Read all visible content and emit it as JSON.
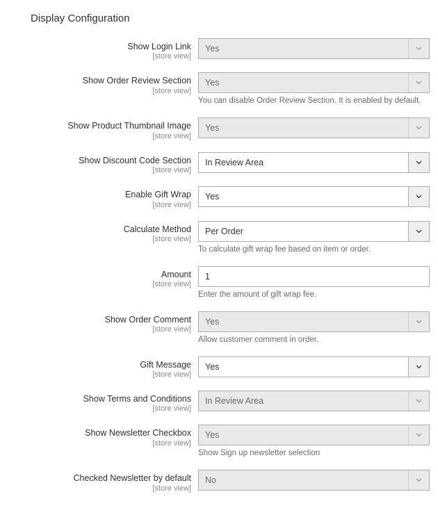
{
  "section": {
    "title": "Display Configuration"
  },
  "scope": {
    "store_view": "[store view]"
  },
  "fields": {
    "login_link": {
      "label": "Show Login Link",
      "value": "Yes"
    },
    "order_review": {
      "label": "Show Order Review Section",
      "value": "Yes",
      "note": "You can disable Order Review Section. It is enabled by default."
    },
    "product_thumb": {
      "label": "Show Product Thumbnail Image",
      "value": "Yes"
    },
    "discount_code": {
      "label": "Show Discount Code Section",
      "value": "In Review Area"
    },
    "gift_wrap": {
      "label": "Enable Gift Wrap",
      "value": "Yes"
    },
    "calc_method": {
      "label": "Calculate Method",
      "value": "Per Order",
      "note": "To calculate gift wrap fee based on item or order."
    },
    "amount": {
      "label": "Amount",
      "value": "1",
      "note": "Enter the amount of gift wrap fee."
    },
    "order_comment": {
      "label": "Show Order Comment",
      "value": "Yes",
      "note": "Allow customer comment in order."
    },
    "gift_message": {
      "label": "Gift Message",
      "value": "Yes"
    },
    "terms": {
      "label": "Show Terms and Conditions",
      "value": "In Review Area"
    },
    "newsletter": {
      "label": "Show Newsletter Checkbox",
      "value": "Yes",
      "note": "Show Sign up newsletter selection"
    },
    "newsletter_def": {
      "label": "Checked Newsletter by default",
      "value": "No"
    }
  }
}
